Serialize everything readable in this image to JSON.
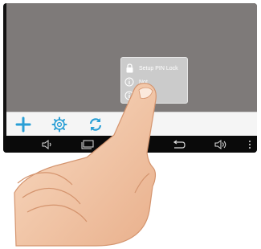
{
  "popup": {
    "items": [
      {
        "label": "Setup PIN Lock",
        "icon": "lock-icon"
      },
      {
        "label": "Not",
        "icon": "info-icon"
      },
      {
        "label": "",
        "icon": "info-icon"
      }
    ]
  },
  "toolbar": {
    "icons": [
      "plus-icon",
      "gear-icon",
      "refresh-icon",
      "partial-icon"
    ]
  },
  "navbar": {
    "icons": [
      "volume-down-icon",
      "recent-apps-icon",
      "home-icon",
      "back-icon",
      "volume-up-icon",
      "menu-icon"
    ]
  },
  "colors": {
    "screen": "#7e7a79",
    "accent": "#2a9fd6",
    "navbar": "#0a0a0a",
    "skin": "#f4c8a6"
  }
}
